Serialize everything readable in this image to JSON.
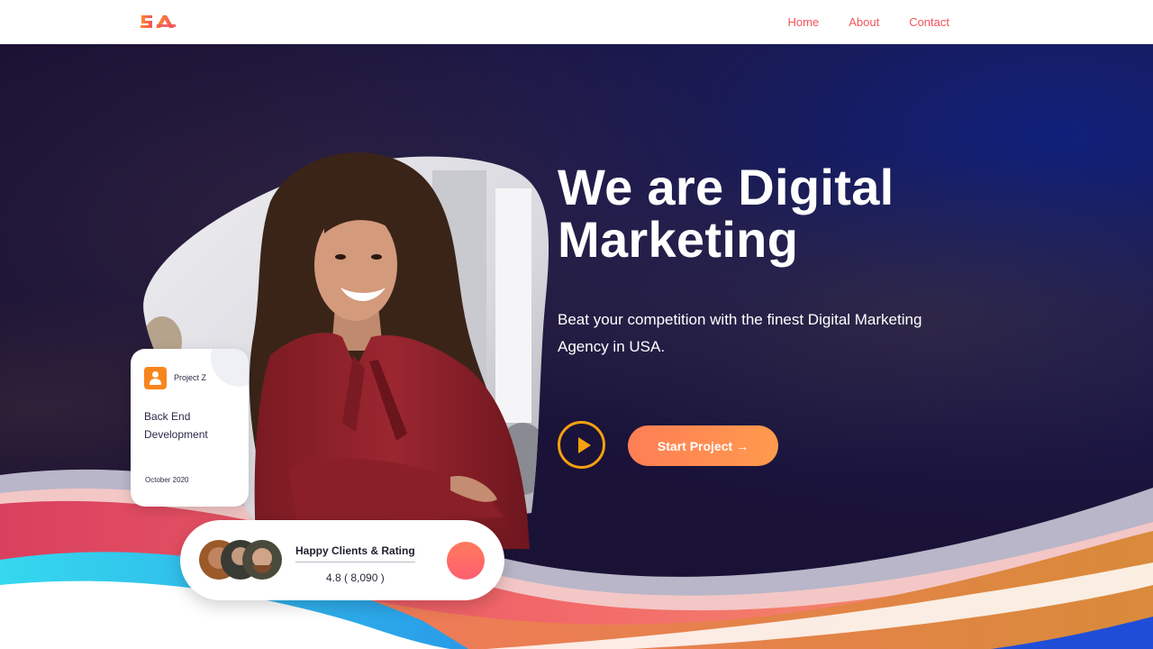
{
  "nav": {
    "logo_text": "SA",
    "links": [
      "Home",
      "About",
      "Contact"
    ]
  },
  "hero": {
    "headline_line1": "We are Digital",
    "headline_line2": "Marketing",
    "subtitle": "Beat your competition with the finest Digital Marketing Agency in USA.",
    "start_button_label": "Start Project →",
    "play_icon": "play-icon"
  },
  "project_card": {
    "name": "Project Z",
    "title": "Back End Development",
    "date": "October 2020",
    "icon": "user-icon"
  },
  "rating_card": {
    "title": "Happy Clients & Rating",
    "value": "4.8 ( 8,090 )"
  },
  "colors": {
    "accent": "#f2545b",
    "orange": "#ff8a50",
    "play": "#f5a00f",
    "hero_bg": "#1c1230"
  }
}
